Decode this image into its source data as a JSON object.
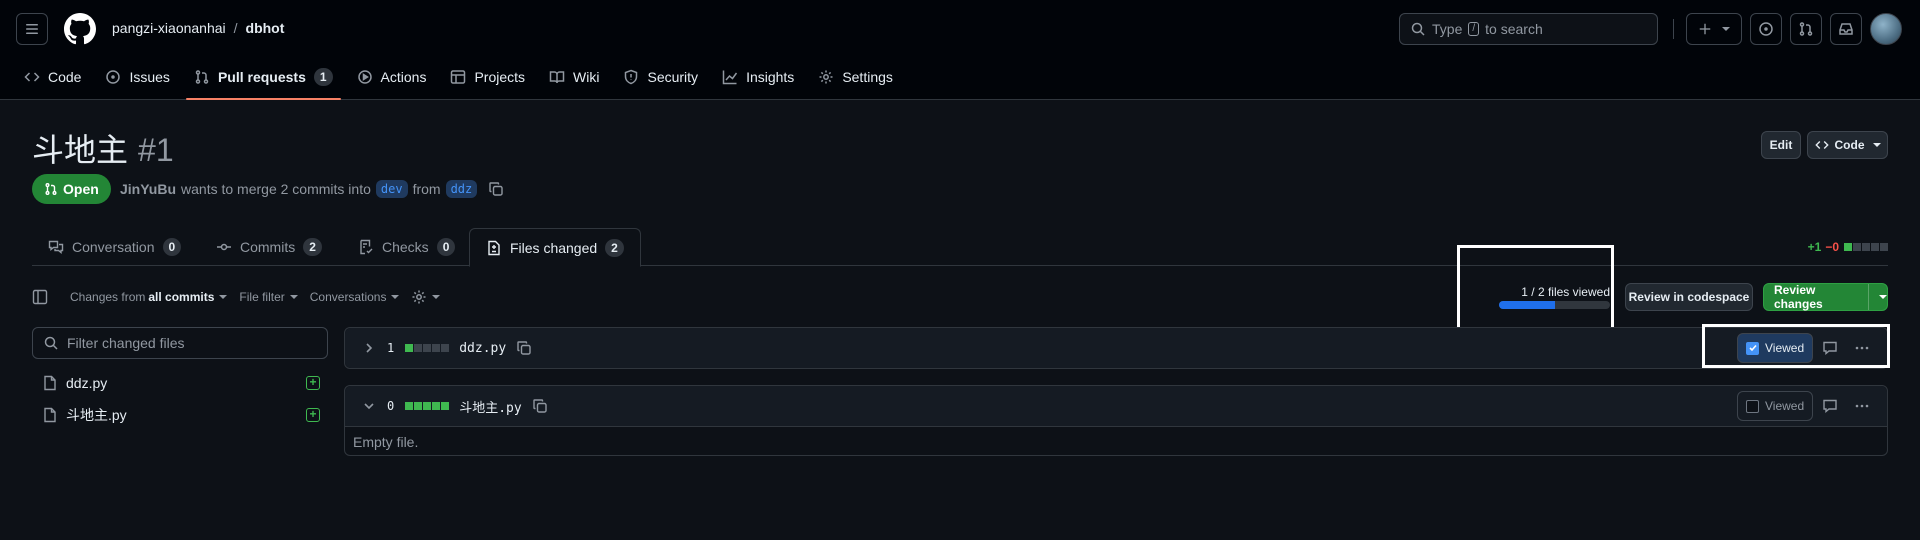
{
  "repo": {
    "owner": "pangzi-xiaonanhai",
    "separator": "/",
    "name": "dbhot"
  },
  "search": {
    "prefix": "Type",
    "key": "/",
    "suffix": "to search"
  },
  "nav_tabs": [
    {
      "label": "Code",
      "icon": "code-icon"
    },
    {
      "label": "Issues",
      "icon": "issue-opened-icon"
    },
    {
      "label": "Pull requests",
      "icon": "git-pull-request-icon",
      "count": "1",
      "selected": true
    },
    {
      "label": "Actions",
      "icon": "play-icon"
    },
    {
      "label": "Projects",
      "icon": "table-icon"
    },
    {
      "label": "Wiki",
      "icon": "book-icon"
    },
    {
      "label": "Security",
      "icon": "shield-icon"
    },
    {
      "label": "Insights",
      "icon": "graph-icon"
    },
    {
      "label": "Settings",
      "icon": "gear-icon"
    }
  ],
  "pr": {
    "title": "斗地主",
    "number": "#1",
    "state": "Open",
    "author": "JinYuBu",
    "action_text": "wants to merge 2 commits into",
    "base_branch": "dev",
    "from_text": "from",
    "head_branch": "ddz",
    "edit_label": "Edit",
    "code_label": "Code"
  },
  "pr_tabs": [
    {
      "label": "Conversation",
      "count": "0",
      "icon": "comment-discussion-icon"
    },
    {
      "label": "Commits",
      "count": "2",
      "icon": "git-commit-icon"
    },
    {
      "label": "Checks",
      "count": "0",
      "icon": "checklist-icon"
    },
    {
      "label": "Files changed",
      "count": "2",
      "icon": "file-diff-icon",
      "active": true
    }
  ],
  "diffstat": {
    "additions": "+1",
    "deletions": "−0"
  },
  "toolbar": {
    "changes_prefix": "Changes from",
    "changes_value": "all commits",
    "file_filter": "File filter",
    "conversations": "Conversations"
  },
  "progress": {
    "text": "1 / 2 files viewed",
    "viewed": 1,
    "total": 2
  },
  "buttons": {
    "review_codespace": "Review in codespace",
    "review_changes": "Review changes"
  },
  "file_tree": {
    "filter_placeholder": "Filter changed files",
    "files": [
      {
        "name": "ddz.py"
      },
      {
        "name": "斗地主.py"
      }
    ]
  },
  "files": [
    {
      "count": "1",
      "name": "ddz.py",
      "viewed_label": "Viewed",
      "viewed": true,
      "collapsed": true
    },
    {
      "count": "0",
      "name": "斗地主.py",
      "viewed_label": "Viewed",
      "viewed": false,
      "collapsed": false,
      "body": "Empty file."
    }
  ],
  "colors": {
    "accent_green": "#238636",
    "tab_underline": "#f78166",
    "link_blue": "#4493f8",
    "progress_blue": "#1f6feb"
  }
}
